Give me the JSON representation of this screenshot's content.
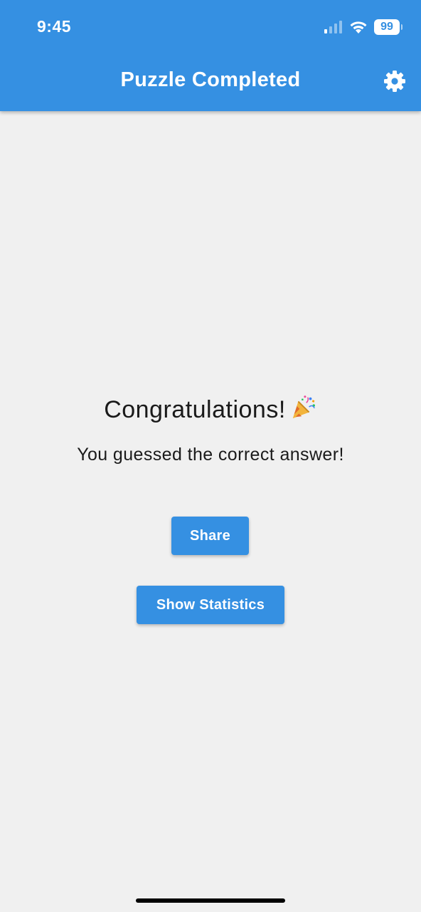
{
  "status_bar": {
    "time": "9:45",
    "battery": "99",
    "icons": [
      "cellular-signal-icon",
      "wifi-icon",
      "battery-icon"
    ]
  },
  "app_bar": {
    "title": "Puzzle Completed",
    "settings_icon": "gear-icon"
  },
  "main": {
    "heading": "Congratulations!",
    "heading_emoji": "party-popper-icon",
    "message": "You guessed the correct answer!",
    "share_label": "Share",
    "statistics_label": "Show Statistics"
  },
  "colors": {
    "primary": "#3590e2",
    "background": "#f0f0f0",
    "text": "#1a1a1a"
  }
}
